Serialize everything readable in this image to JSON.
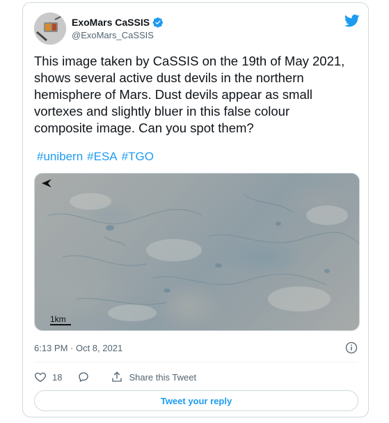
{
  "author": {
    "display_name": "ExoMars CaSSIS",
    "handle": "@ExoMars_CaSSIS",
    "verified": true
  },
  "tweet": {
    "text": "This image taken by CaSSIS on the 19th of May 2021,\nshows several active dust devils in the northern\nhemisphere of Mars. Dust devils appear as small\nvortexes and slightly bluer in this false colour\ncomposite image. Can you spot them?",
    "hashtags": [
      "#unibern",
      "#ESA",
      "#TGO"
    ],
    "media": {
      "scale_label": "1km"
    },
    "timestamp": "6:13 PM · Oct 8, 2021"
  },
  "actions": {
    "like_count": "18",
    "share_label": "Share this Tweet",
    "reply_button_label": "Tweet your reply"
  },
  "colors": {
    "accent": "#1d9bf0",
    "secondary_text": "#536471",
    "border": "#cfd9de"
  },
  "icons": [
    "twitter-bird-icon",
    "verified-icon",
    "north-arrow-icon",
    "info-icon",
    "heart-icon",
    "reply-icon",
    "share-icon"
  ]
}
